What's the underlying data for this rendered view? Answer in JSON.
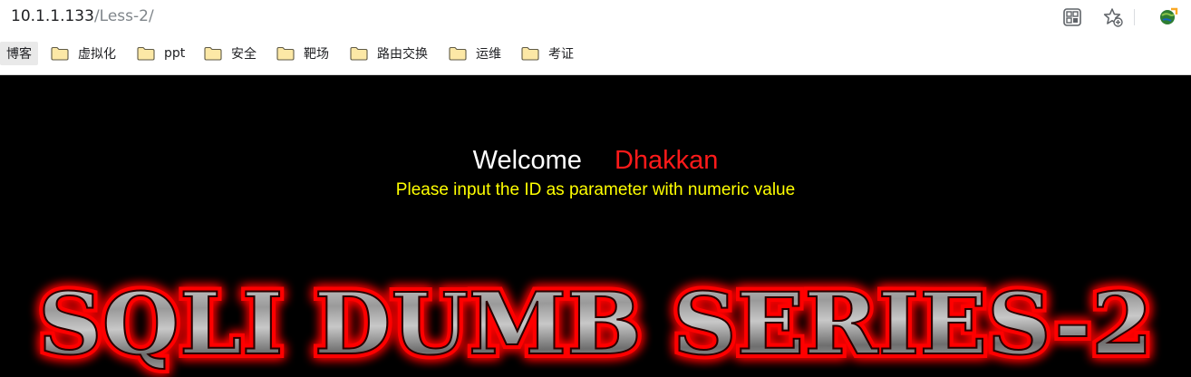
{
  "address_bar": {
    "host": "10.1.1.133",
    "path": "/Less-2/"
  },
  "toolbar_icons": [
    "qr-grid-icon",
    "star-add-icon",
    "extension-globe-icon"
  ],
  "bookmarks": {
    "items": [
      {
        "label": "博客",
        "icon": "none"
      },
      {
        "label": "虚拟化",
        "icon": "folder-icon"
      },
      {
        "label": "ppt",
        "icon": "folder-icon"
      },
      {
        "label": "安全",
        "icon": "folder-icon"
      },
      {
        "label": "靶场",
        "icon": "folder-icon"
      },
      {
        "label": "路由交换",
        "icon": "folder-icon"
      },
      {
        "label": "运维",
        "icon": "folder-icon"
      },
      {
        "label": "考证",
        "icon": "folder-icon"
      }
    ]
  },
  "page": {
    "welcome": "Welcome",
    "name": "Dhakkan",
    "instruction": "Please input the ID as parameter with numeric value",
    "banner_text": "SQLI DUMB SERIES-2",
    "colors": {
      "background": "#000000",
      "welcome": "#ffffff",
      "name": "#ff1a1a",
      "instruction": "#ffff00",
      "banner_glow": "#ff0000"
    }
  }
}
